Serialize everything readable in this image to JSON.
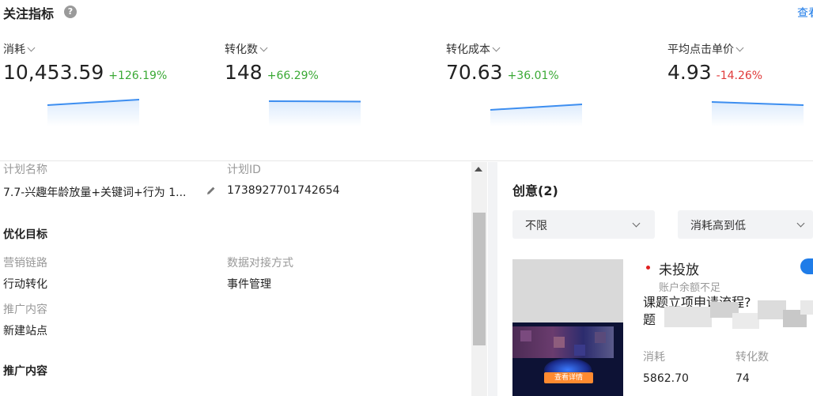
{
  "header": {
    "title": "关注指标",
    "help_icon": "question-circle-icon",
    "view_link": "查看"
  },
  "metrics": [
    {
      "name": "消耗",
      "value": "10,453.59",
      "change": "+126.19%",
      "trend": "up"
    },
    {
      "name": "转化数",
      "value": "148",
      "change": "+66.29%",
      "trend": "up"
    },
    {
      "name": "转化成本",
      "value": "70.63",
      "change": "+36.01%",
      "trend": "up"
    },
    {
      "name": "平均点击单价",
      "value": "4.93",
      "change": "-14.26%",
      "trend": "down"
    }
  ],
  "colors": {
    "up": "#3aa935",
    "down": "#e03a3a",
    "accent": "#1f7ce8",
    "spark_line": "#3d8ef0"
  },
  "plan": {
    "name_label": "计划名称",
    "name_value": "7.7-兴趣年龄放量+关键词+行为 1...",
    "edit_icon": "pencil-icon",
    "id_label": "计划ID",
    "id_value": "1738927701742654",
    "opt_section": "优化目标",
    "chain_label": "营销链路",
    "chain_value": "行动转化",
    "data_label": "数据对接方式",
    "data_value": "事件管理",
    "promo_label": "推广内容",
    "promo_value": "新建站点",
    "promo_section": "推广内容"
  },
  "creative": {
    "title": "创意(2)",
    "filter_value": "不限",
    "sort_value": "消耗高到低",
    "status": "未投放",
    "status_sub": "账户余额不足",
    "item_title": "课题立项申请流程?　　　　　　　　　　　　　 题",
    "thumb_button": "查看详情",
    "stats": [
      {
        "label": "消耗",
        "value": "5862.70"
      },
      {
        "label": "转化数",
        "value": "74"
      }
    ]
  }
}
